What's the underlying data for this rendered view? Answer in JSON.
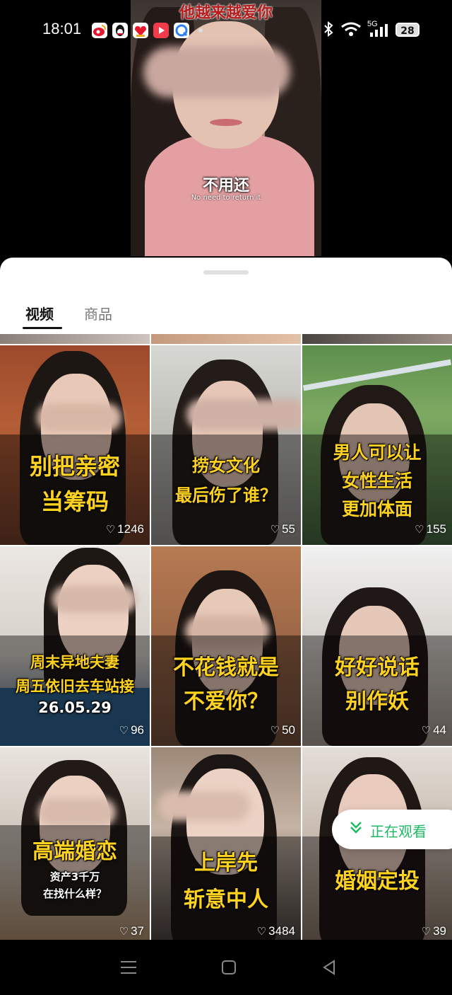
{
  "status_bar": {
    "time": "18:01",
    "network": "5G",
    "battery": "28",
    "app_icons": [
      "weibo-icon",
      "qq-icon",
      "gift-app-icon",
      "video-app-icon",
      "browser-app-icon"
    ]
  },
  "video": {
    "caption_top": "他越来越爱你",
    "subtitle_cn": "不用还",
    "subtitle_en": "No need to return it"
  },
  "tabs": [
    {
      "label": "视频",
      "active": true
    },
    {
      "label": "商品",
      "active": false
    }
  ],
  "grid": [
    {
      "lines": [
        "别把亲密",
        "当筹码"
      ],
      "likes": "1246"
    },
    {
      "lines": [
        "捞女文化",
        "最后伤了谁？"
      ],
      "likes": "55"
    },
    {
      "lines": [
        "男人可以让",
        "女性生活",
        "更加体面"
      ],
      "likes": "155"
    },
    {
      "lines": [
        "周末异地夫妻",
        "周五依旧去车站接",
        "26.05.29"
      ],
      "likes": "96"
    },
    {
      "lines": [
        "不花钱就是",
        "不爱你？"
      ],
      "likes": "50"
    },
    {
      "lines": [
        "好好说话",
        "别作妖"
      ],
      "likes": "44"
    },
    {
      "lines": [
        "高端婚恋",
        "资产3千万",
        "在找什么样？"
      ],
      "likes": "37"
    },
    {
      "lines": [
        "上岸先",
        "斩意中人"
      ],
      "likes": "3484"
    },
    {
      "lines": [
        "婚姻定投"
      ],
      "likes": "39"
    }
  ],
  "watching_button": {
    "label": "正在观看",
    "icon": "double-chevron-down-icon"
  },
  "colors": {
    "accent": "#1fb964",
    "caption": "#ffd21f"
  },
  "nav": [
    "menu-icon",
    "home-icon",
    "back-icon"
  ]
}
